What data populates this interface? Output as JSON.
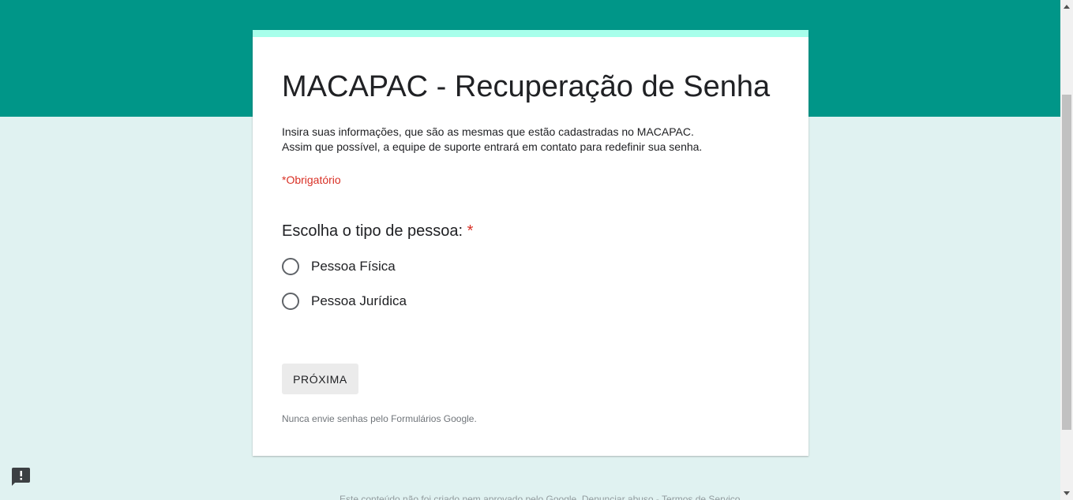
{
  "form": {
    "title": "MACAPAC - Recuperação de Senha",
    "description_line1": "Insira suas informações, que são as mesmas que estão cadastradas no MACAPAC.",
    "description_line2": "Assim que possível, a equipe de suporte entrará em contato para redefinir sua senha.",
    "required_note": "*Obrigatório",
    "question": {
      "label": "Escolha o tipo de pessoa:",
      "required_mark": "*",
      "options": [
        "Pessoa Física",
        "Pessoa Jurídica"
      ]
    },
    "next_button": "PRÓXIMA",
    "footer_note": "Nunca envie senhas pelo Formulários Google."
  },
  "page_footer_text": "Este conteúdo não foi criado nem aprovado pelo Google. Denunciar abuso - Termos de Serviço",
  "icons": {
    "feedback": "feedback-icon",
    "scroll_up": "chevron-up-icon",
    "scroll_down": "chevron-down-icon"
  },
  "colors": {
    "header_band": "#009688",
    "page_background": "#e0f2f1",
    "card_accent": "#a7ffeb",
    "required": "#d93025"
  }
}
